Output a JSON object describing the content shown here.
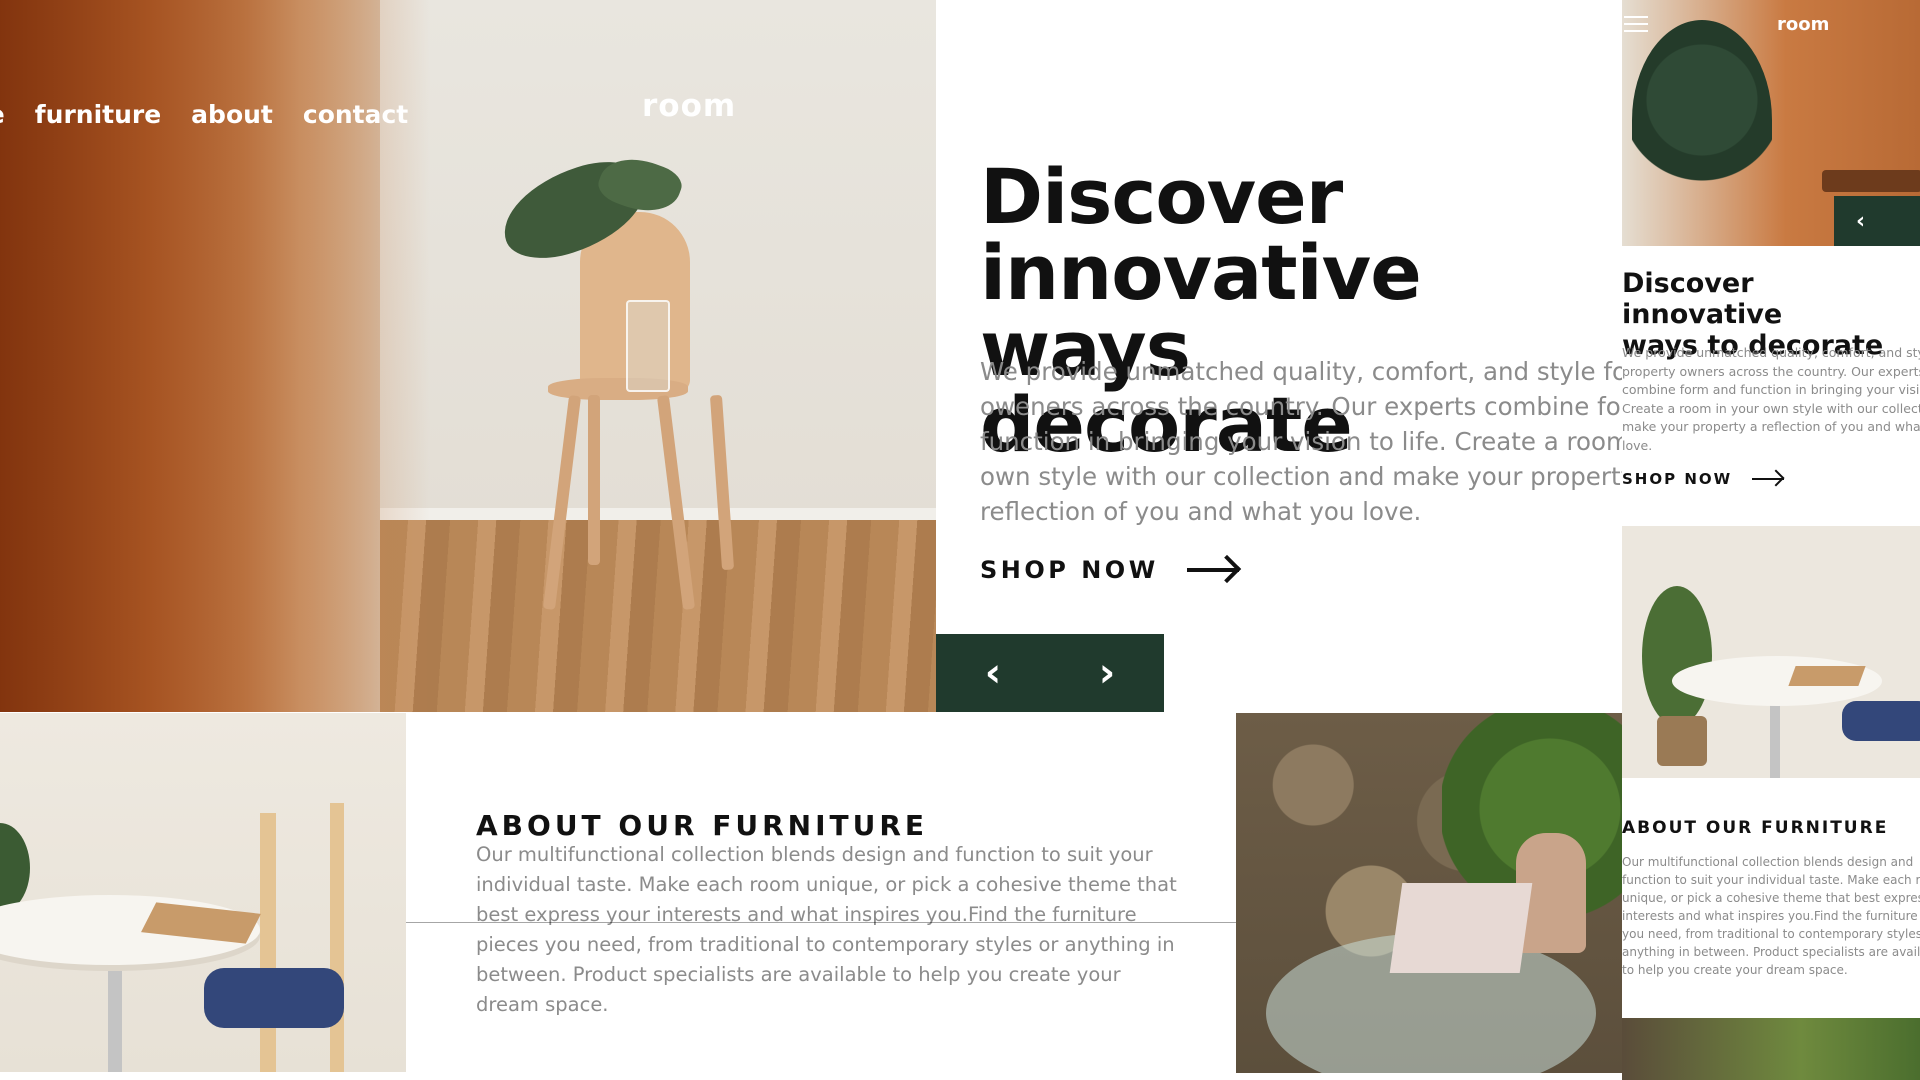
{
  "nav": {
    "links": [
      "ne",
      "furniture",
      "about",
      "contact"
    ],
    "logo": "room"
  },
  "hero": {
    "title_lines": [
      "Discover",
      "innovative ways",
      "decorate"
    ],
    "desc_lines": [
      "We provide unmatched quality, comfort, and style for",
      "oweners across the country. Our experts combine form",
      "function in bringing your vision to life. Create a room in",
      "own style with our collection and make your property a",
      "reflection of you and what you love."
    ],
    "shop_label": "SHOP NOW",
    "prev_icon": "‹",
    "next_icon": "›"
  },
  "about": {
    "title": "ABOUT OUR FURNITURE",
    "desc_lines": [
      "Our multifunctional collection blends design and function to suit your",
      "individual taste. Make each room unique, or pick a cohesive theme that",
      "best express your interests and what inspires you.Find the furniture",
      "pieces you need, from traditional to contemporary styles or anything in",
      "between. Product specialists are available to help you create your",
      "dream space."
    ]
  },
  "mobile": {
    "logo": "room",
    "prev_icon": "‹",
    "title_lines": [
      "Discover innovative",
      "ways to decorate"
    ],
    "desc_lines": [
      "We provide unmatched quality, comfort, and style for",
      "property owners across the country. Our experts",
      "combine form and function in bringing your vision to",
      "Create a room in your own style with our collection and",
      "make your property a reflection of you and what you",
      "love."
    ],
    "shop_label": "SHOP NOW",
    "about_title": "ABOUT OUR FURNITURE",
    "about_lines": [
      "Our multifunctional collection blends design and",
      "function to suit your individual taste. Make each room",
      "unique, or pick a cohesive theme that best express your",
      "interests and what inspires you.Find the furniture pieces",
      "you need, from traditional to contemporary styles or",
      "anything in between. Product specialists are available",
      "to help you create your dream space."
    ]
  },
  "colors": {
    "accent": "#203a2d",
    "text": "#111111",
    "muted": "#8b8b8b"
  },
  "icons": [
    "menu-icon",
    "chevron-left-icon",
    "chevron-right-icon",
    "arrow-right-icon"
  ]
}
